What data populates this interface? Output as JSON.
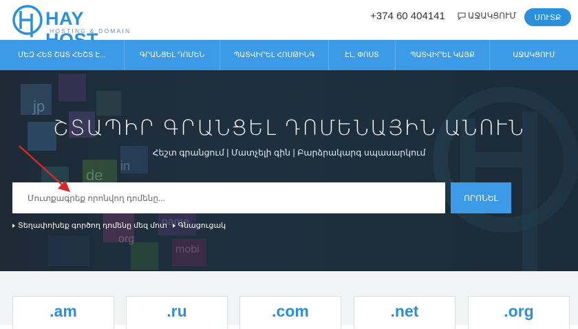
{
  "header": {
    "logo_text": "HAY HOST",
    "logo_sub": "HOSTING & DOMAIN",
    "phone": "+374 60 404141",
    "support_label": "ԱՋԱԿՑՈՒՄ",
    "login_label": "ՄՈՒՏՔ"
  },
  "nav": {
    "items": [
      {
        "label": "ՄԵԶ ՀԵՏ ՇԱՏ ՀԵՇՏ Է..."
      },
      {
        "label": "ԳՐԱՆՑԵԼ ԴՈՄԵՆ"
      },
      {
        "label": "ՊԱՏՎԻՐԵԼ ՀՈՍԹԻՆԳ"
      },
      {
        "label": "ԷԼ. ՓՈՍՏ"
      },
      {
        "label": "ՊԱՏՎԻՐԵԼ ԿԱՅՔ"
      },
      {
        "label": "ԱՋԱԿՑՈՒՄ"
      }
    ]
  },
  "hero": {
    "title": "ՇՏԱՊԻՐ ԳՐԱՆՑԵԼ ԴՈՄԵՆԱՅԻՆ ԱՆՈՒՆ",
    "subtitle": "Հեշտ գրանցում | Մատչելի գին | Բարձրակարգ սպասարկում",
    "search_placeholder": "Մուտքագրեք որոնվող դոմենը...",
    "search_button": "ՈՐՈՆԵԼ",
    "link_transfer": "Տեղափոխեք գործող դոմենը մեզ մոտ",
    "link_prices": "Գնացուցակ"
  },
  "tlds": [
    ".am",
    ".ru",
    ".com",
    ".net",
    ".org"
  ],
  "colors": {
    "brand_blue": "#3d9ae6",
    "logo_blue": "#2a8fdd",
    "hero_dark": "#1f3344",
    "arrow_red": "#d9262b"
  }
}
